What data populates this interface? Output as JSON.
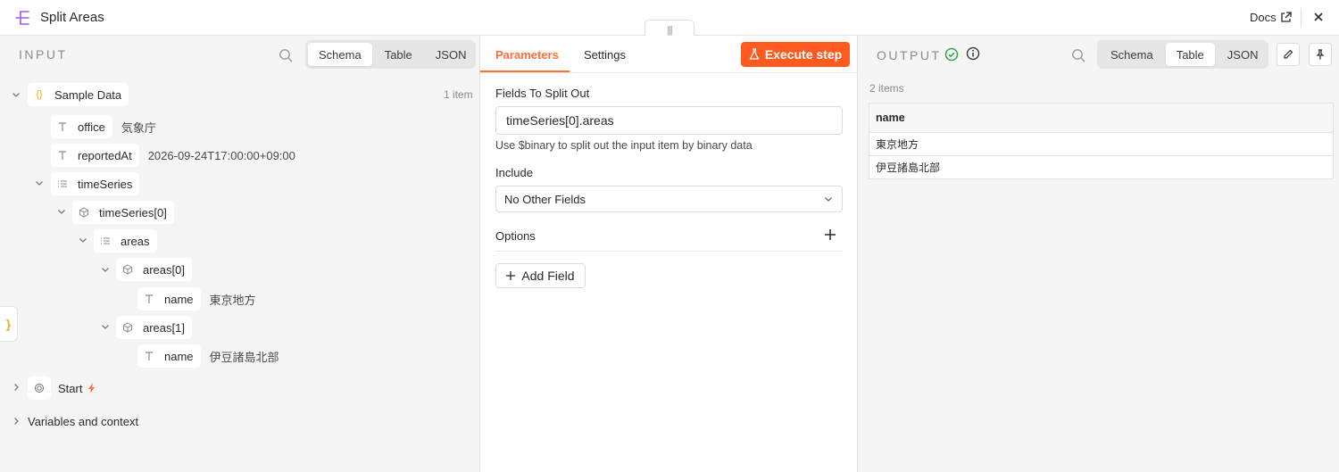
{
  "header": {
    "title": "Split Areas",
    "docs_label": "Docs",
    "drag_handle_glyph": "|||"
  },
  "input": {
    "label": "INPUT",
    "view_tabs": [
      "Schema",
      "Table",
      "JSON"
    ],
    "active_view": "Schema",
    "root": {
      "label": "Sample Data",
      "count": "1 item"
    },
    "fields": {
      "office": {
        "key": "office",
        "value": "気象庁"
      },
      "reportedAt": {
        "key": "reportedAt",
        "value": "2026-09-24T17:00:00+09:00"
      },
      "timeSeries": {
        "key": "timeSeries"
      },
      "timeSeries0": {
        "key": "timeSeries[0]"
      },
      "areas": {
        "key": "areas"
      },
      "areas0": {
        "key": "areas[0]"
      },
      "areas0_name": {
        "key": "name",
        "value": "東京地方"
      },
      "areas1": {
        "key": "areas[1]"
      },
      "areas1_name": {
        "key": "name",
        "value": "伊豆諸島北部"
      }
    },
    "start_label": "Start",
    "variables_label": "Variables and context",
    "side_tab_glyph": "}"
  },
  "params": {
    "tabs": [
      "Parameters",
      "Settings"
    ],
    "active_tab": "Parameters",
    "execute_label": "Execute step",
    "fields_to_split_label": "Fields To Split Out",
    "fields_to_split_value": "timeSeries[0].areas",
    "hint": "Use $binary to split out the input item by binary data",
    "include_label": "Include",
    "include_value": "No Other Fields",
    "options_label": "Options",
    "add_field_label": "Add Field"
  },
  "output": {
    "label": "OUTPUT",
    "view_tabs": [
      "Schema",
      "Table",
      "JSON"
    ],
    "active_view": "Table",
    "count": "2 items",
    "table": {
      "columns": [
        "name"
      ],
      "rows": [
        [
          "東京地方"
        ],
        [
          "伊豆諸島北部"
        ]
      ]
    }
  },
  "colors": {
    "accent": "#ff6d3b",
    "execute": "#ff5a1f",
    "success": "#2ea44f",
    "object_badge": "#f5a623",
    "node_icon": "#9b5de5"
  }
}
